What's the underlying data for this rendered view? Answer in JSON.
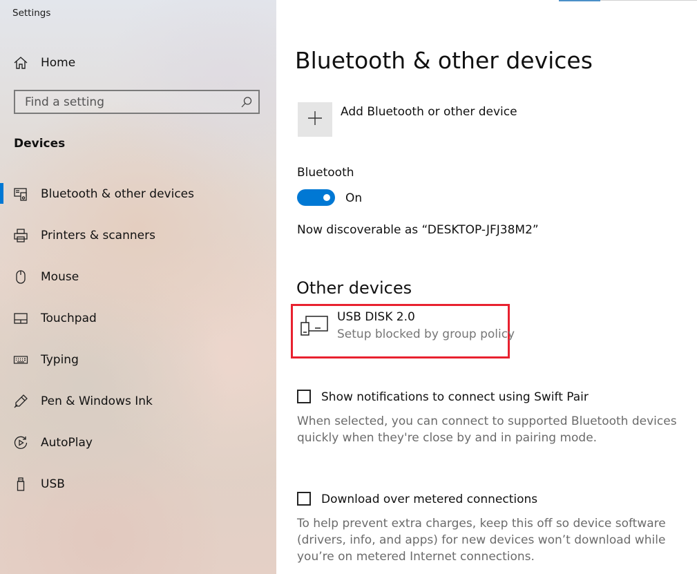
{
  "window": {
    "title": "Settings"
  },
  "sidebar": {
    "home_label": "Home",
    "search": {
      "placeholder": "Find a setting",
      "icon": "search-icon"
    },
    "section_title": "Devices",
    "items": [
      {
        "label": "Bluetooth & other devices",
        "icon": "bluetooth-devices-icon",
        "active": true
      },
      {
        "label": "Printers & scanners",
        "icon": "printer-icon",
        "active": false
      },
      {
        "label": "Mouse",
        "icon": "mouse-icon",
        "active": false
      },
      {
        "label": "Touchpad",
        "icon": "touchpad-icon",
        "active": false
      },
      {
        "label": "Typing",
        "icon": "keyboard-icon",
        "active": false
      },
      {
        "label": "Pen & Windows Ink",
        "icon": "pen-icon",
        "active": false
      },
      {
        "label": "AutoPlay",
        "icon": "autoplay-icon",
        "active": false
      },
      {
        "label": "USB",
        "icon": "usb-icon",
        "active": false
      }
    ]
  },
  "main": {
    "title": "Bluetooth & other devices",
    "add_device_label": "Add Bluetooth or other device",
    "bluetooth": {
      "label": "Bluetooth",
      "state": "On",
      "enabled": true
    },
    "discoverable_text": "Now discoverable as “DESKTOP-JFJ38M2”",
    "other_devices": {
      "title": "Other devices",
      "devices": [
        {
          "name": "USB DISK 2.0",
          "status": "Setup blocked by group policy",
          "icon": "storage-device-icon"
        }
      ]
    },
    "swift_pair": {
      "label": "Show notifications to connect using Swift Pair",
      "checked": false,
      "description": "When selected, you can connect to supported Bluetooth devices quickly when they're close by and in pairing mode."
    },
    "metered": {
      "label": "Download over metered connections",
      "checked": false,
      "description": "To help prevent extra charges, keep this off so device software (drivers, info, and apps) for new devices won’t download while you’re on metered Internet connections."
    }
  },
  "colors": {
    "accent": "#0078d4",
    "highlight_box": "#e8212f",
    "secondary_text": "#767676"
  }
}
